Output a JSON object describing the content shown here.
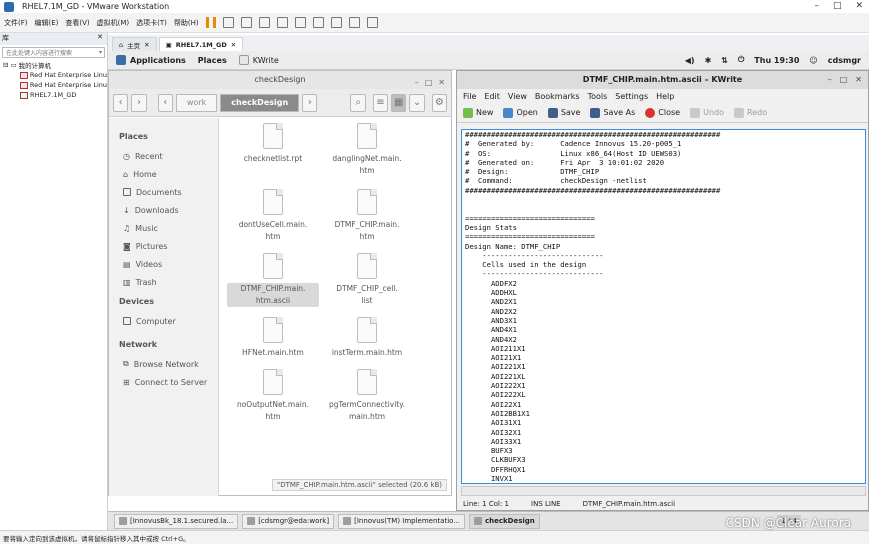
{
  "vmware": {
    "title": "RHEL7.1M_GD - VMware Workstation",
    "menu": [
      "文件(F)",
      "编辑(E)",
      "查看(V)",
      "虚拟机(M)",
      "选项卡(T)",
      "帮助(H)"
    ],
    "library_title": "库",
    "library_search_placeholder": "在此处键入内容进行搜索",
    "tree_root": "我的计算机",
    "tree_items": [
      "Red Hat Enterprise Linu",
      "Red Hat Enterprise Linu",
      "RHEL7.1M_GD"
    ],
    "tabs": [
      "主页",
      "RHEL7.1M_GD"
    ],
    "status_text": "要将输入定向到该虚拟机，请将鼠标指针移入其中或按 Ctrl+G。"
  },
  "gnome_top": {
    "applications": "Applications",
    "places": "Places",
    "active_app": "KWrite",
    "clock": "Thu 19:30",
    "user": "cdsmgr"
  },
  "nautilus": {
    "title": "checkDesign",
    "crumbs": [
      "work",
      "checkDesign"
    ],
    "sidebar": {
      "places_header": "Places",
      "places": [
        "Recent",
        "Home",
        "Documents",
        "Downloads",
        "Music",
        "Pictures",
        "Videos",
        "Trash"
      ],
      "devices_header": "Devices",
      "devices": [
        "Computer"
      ],
      "network_header": "Network",
      "network": [
        "Browse Network",
        "Connect to Server"
      ]
    },
    "files": [
      {
        "line1": "checknetlist.rpt",
        "line2": ""
      },
      {
        "line1": "danglingNet.main.",
        "line2": "htm"
      },
      {
        "line1": "dontUseCell.main.",
        "line2": "htm"
      },
      {
        "line1": "DTMF_CHIP.main.",
        "line2": "htm"
      },
      {
        "line1": "DTMF_CHIP.main.",
        "line2": "htm.ascii"
      },
      {
        "line1": "DTMF_CHIP_cell.",
        "line2": "list"
      },
      {
        "line1": "HFNet.main.htm",
        "line2": ""
      },
      {
        "line1": "instTerm.main.htm",
        "line2": ""
      },
      {
        "line1": "noOutputNet.main.",
        "line2": "htm"
      },
      {
        "line1": "pgTermConnectivity.",
        "line2": "main.htm"
      }
    ],
    "status": "\"DTMF_CHIP.main.htm.ascii\" selected (20.6 kB)"
  },
  "kwrite": {
    "title": "DTMF_CHIP.main.htm.ascii – KWrite",
    "menu": [
      "File",
      "Edit",
      "View",
      "Bookmarks",
      "Tools",
      "Settings",
      "Help"
    ],
    "toolbar": {
      "new": "New",
      "open": "Open",
      "save": "Save",
      "save_as": "Save As",
      "close": "Close",
      "undo": "Undo",
      "redo": "Redo"
    },
    "content": "###########################################################\n#  Generated by:      Cadence Innovus 15.20-p005_1\n#  OS:                Linux x86_64(Host ID UEWS03)\n#  Generated on:      Fri Apr  3 10:01:02 2020\n#  Design:            DTMF_CHIP\n#  Command:           checkDesign -netlist\n###########################################################\n\n\n==============================\nDesign Stats\n==============================\nDesign Name: DTMF_CHIP\n    ----------------------------\n    Cells used in the design\n    ----------------------------\n      ADDFX2\n      ADDHXL\n      AND2X1\n      AND2X2\n      AND3X1\n      AND4X1\n      AND4X2\n      AOI211X1\n      AOI21X1\n      AOI221X1\n      AOI221XL\n      AOI222X1\n      AOI222XL\n      AOI22X1\n      AOI2BB1X1\n      AOI31X1\n      AOI32X1\n      AOI33X1\n      BUFX3\n      CLKBUFX3\n      DFFRHQX1\n      INVX1",
    "status": {
      "position": "Line: 1 Col: 1",
      "mode": "INS  LINE",
      "file": "DTMF_CHIP.main.htm.ascii"
    }
  },
  "taskbar": {
    "items": [
      "[InnovusBk_18.1.secured.la...",
      "[cdsmgr@eda:work]",
      "[Innovus(TM) Implementatio...",
      "checkDesign"
    ],
    "pager": "1 / 4"
  },
  "watermark": "CSDN @Clear Aurora"
}
